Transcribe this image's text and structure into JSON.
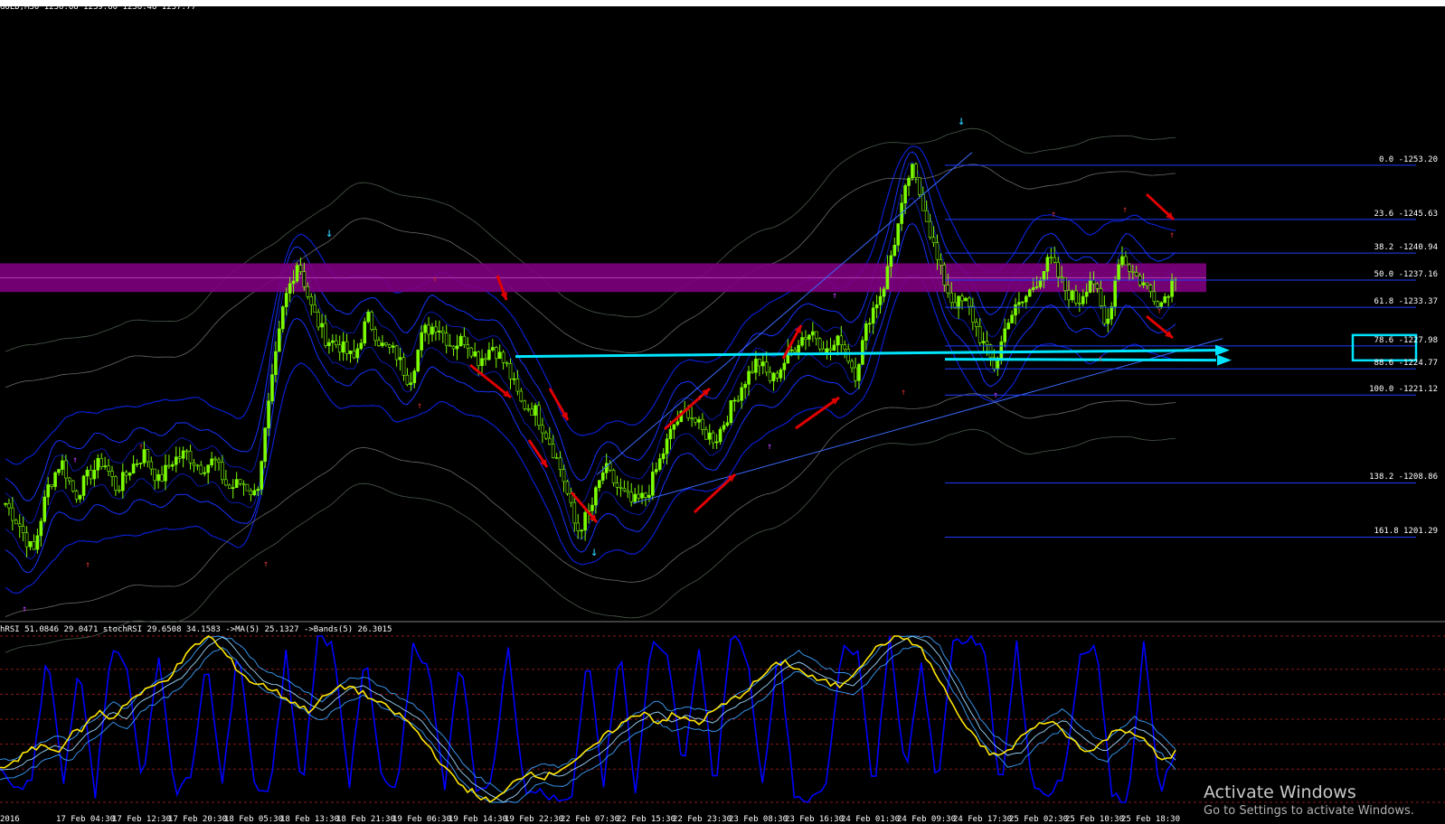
{
  "symbol_line": "GOLD,M30  1236.68 1239.80 1236.48 1237.77",
  "indicator_line": "hRSI 51.0846 29.0471  stochRSI 29.6508 34.1583  ->MA(5) 25.1327  ->Bands(5) 26.3015",
  "watermark": {
    "title": "Activate Windows",
    "subtitle": "Go to Settings to activate Windows."
  },
  "colors": {
    "background": "#000000",
    "bull_candle": "#7cfc00",
    "zone": "#800080",
    "fib": "#1e3cff",
    "arrow": "#e00000",
    "support_line": "#00e5ff",
    "stoch": "#ffe600",
    "hrsi": "#0000ff"
  },
  "chart_data": {
    "type": "candlestick",
    "symbol": "GOLD",
    "timeframe": "M30",
    "last_bar": {
      "open": 1236.68,
      "high": 1239.8,
      "low": 1236.48,
      "close": 1237.77
    },
    "price_range": [
      1190,
      1275
    ],
    "resistance_zone": [
      1235.5,
      1239.5
    ],
    "support_level": 1226.5,
    "fibonacci": [
      {
        "label": "0.0 -1253.20",
        "price": 1253.2
      },
      {
        "label": "23.6 -1245.63",
        "price": 1245.63
      },
      {
        "label": "38.2 -1240.94",
        "price": 1240.94
      },
      {
        "label": "50.0 -1237.16",
        "price": 1237.16
      },
      {
        "label": "61.8 -1233.37",
        "price": 1233.37
      },
      {
        "label": "78.6 -1227.98",
        "price": 1227.98
      },
      {
        "label": "88.6 -1224.77",
        "price": 1224.77
      },
      {
        "label": "100.0 -1221.12",
        "price": 1221.12
      },
      {
        "label": "138.2 -1208.86",
        "price": 1208.86
      },
      {
        "label": "161.8 1201.29",
        "price": 1201.29
      }
    ],
    "time_labels": [
      "2016",
      "17 Feb 04:30",
      "17 Feb 12:30",
      "17 Feb 20:30",
      "18 Feb 05:30",
      "18 Feb 13:30",
      "18 Feb 21:30",
      "19 Feb 06:30",
      "19 Feb 14:30",
      "19 Feb 22:30",
      "22 Feb 07:30",
      "22 Feb 15:30",
      "22 Feb 23:30",
      "23 Feb 08:30",
      "23 Feb 16:30",
      "24 Feb 01:30",
      "24 Feb 09:30",
      "24 Feb 17:30",
      "25 Feb 02:30",
      "25 Feb 10:30",
      "25 Feb 18:30"
    ],
    "price_path": [
      1206,
      1203,
      1199,
      1208,
      1212,
      1207,
      1210,
      1212,
      1208,
      1211,
      1213,
      1209,
      1212,
      1213,
      1211,
      1212,
      1208,
      1209,
      1207,
      1221,
      1234,
      1240,
      1233,
      1229,
      1228,
      1226,
      1232,
      1228,
      1227,
      1223,
      1230,
      1231,
      1228,
      1229,
      1226,
      1228,
      1225,
      1220,
      1219,
      1215,
      1210,
      1202,
      1205,
      1211,
      1208,
      1206,
      1207,
      1212,
      1217,
      1219,
      1216,
      1215,
      1219,
      1223,
      1226,
      1223,
      1226,
      1229,
      1230,
      1227,
      1229,
      1224,
      1232,
      1236,
      1244,
      1253,
      1247,
      1239,
      1234,
      1234,
      1229,
      1225,
      1232,
      1234,
      1237,
      1240,
      1236,
      1234,
      1238,
      1230,
      1241,
      1238,
      1236,
      1234,
      1238
    ],
    "hrsi_path": [
      20,
      5,
      15,
      90,
      10,
      85,
      5,
      95,
      80,
      10,
      90,
      5,
      15,
      85,
      10,
      95,
      10,
      5,
      90,
      5,
      100,
      95,
      10,
      90,
      15,
      5,
      95,
      80,
      10,
      90,
      5,
      15,
      95,
      5,
      10,
      0,
      5,
      90,
      10,
      95,
      5,
      100,
      90,
      15,
      95,
      5,
      100,
      90,
      10,
      95,
      5,
      0,
      10,
      95,
      90,
      5,
      100,
      15,
      85,
      10,
      95,
      100,
      90,
      5,
      95,
      10,
      5,
      15,
      90,
      95,
      5,
      0,
      95,
      5,
      30
    ],
    "stoch_path": [
      20,
      25,
      30,
      35,
      30,
      40,
      45,
      55,
      50,
      60,
      65,
      70,
      75,
      85,
      95,
      100,
      90,
      80,
      72,
      70,
      65,
      60,
      55,
      62,
      68,
      70,
      65,
      60,
      55,
      50,
      40,
      30,
      18,
      10,
      5,
      0,
      5,
      15,
      18,
      15,
      20,
      25,
      30,
      38,
      45,
      50,
      55,
      48,
      52,
      50,
      48,
      55,
      60,
      65,
      72,
      80,
      85,
      80,
      75,
      72,
      70,
      78,
      88,
      95,
      100,
      98,
      90,
      75,
      60,
      45,
      35,
      28,
      30,
      40,
      45,
      50,
      42,
      35,
      30,
      38,
      45,
      42,
      35,
      25,
      30
    ]
  }
}
